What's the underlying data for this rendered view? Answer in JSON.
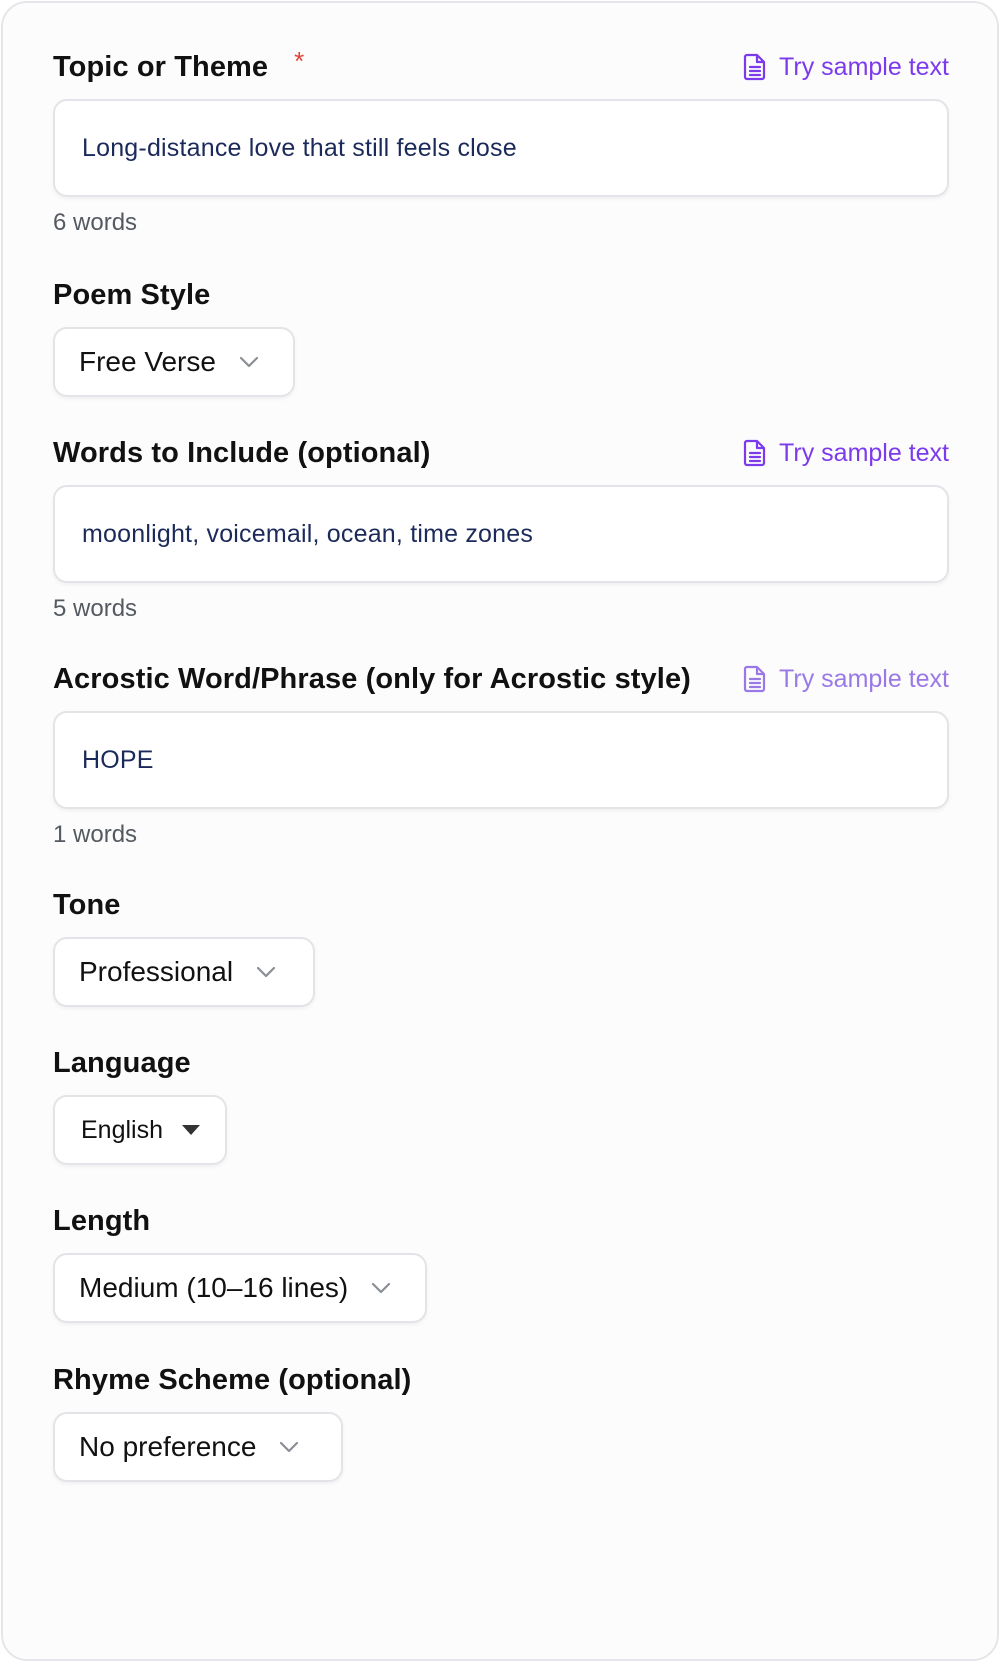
{
  "fields": {
    "topic": {
      "label": "Topic or Theme",
      "required_marker": "*",
      "sample_link": "Try sample text",
      "value": "Long-distance love that still feels close",
      "word_count": "6 words"
    },
    "poem_style": {
      "label": "Poem Style",
      "selected": "Free Verse"
    },
    "words_to_include": {
      "label": "Words to Include (optional)",
      "sample_link": "Try sample text",
      "value": "moonlight, voicemail, ocean, time zones",
      "word_count": "5 words"
    },
    "acrostic": {
      "label": "Acrostic Word/Phrase (only for Acrostic style)",
      "sample_link": "Try sample text",
      "value": "HOPE",
      "word_count": "1 words"
    },
    "tone": {
      "label": "Tone",
      "selected": "Professional"
    },
    "language": {
      "label": "Language",
      "selected": "English"
    },
    "length": {
      "label": "Length",
      "selected": "Medium (10–16 lines)"
    },
    "rhyme_scheme": {
      "label": "Rhyme Scheme (optional)",
      "selected": "No preference"
    }
  },
  "colors": {
    "accent": "#7c3aed",
    "required": "#e0443a",
    "input_text": "#1b2a5a",
    "counter_text": "#555a60"
  },
  "icons": {
    "sample_link": "document-icon",
    "select": "chevron-down-icon",
    "native_select": "caret-down-icon"
  }
}
